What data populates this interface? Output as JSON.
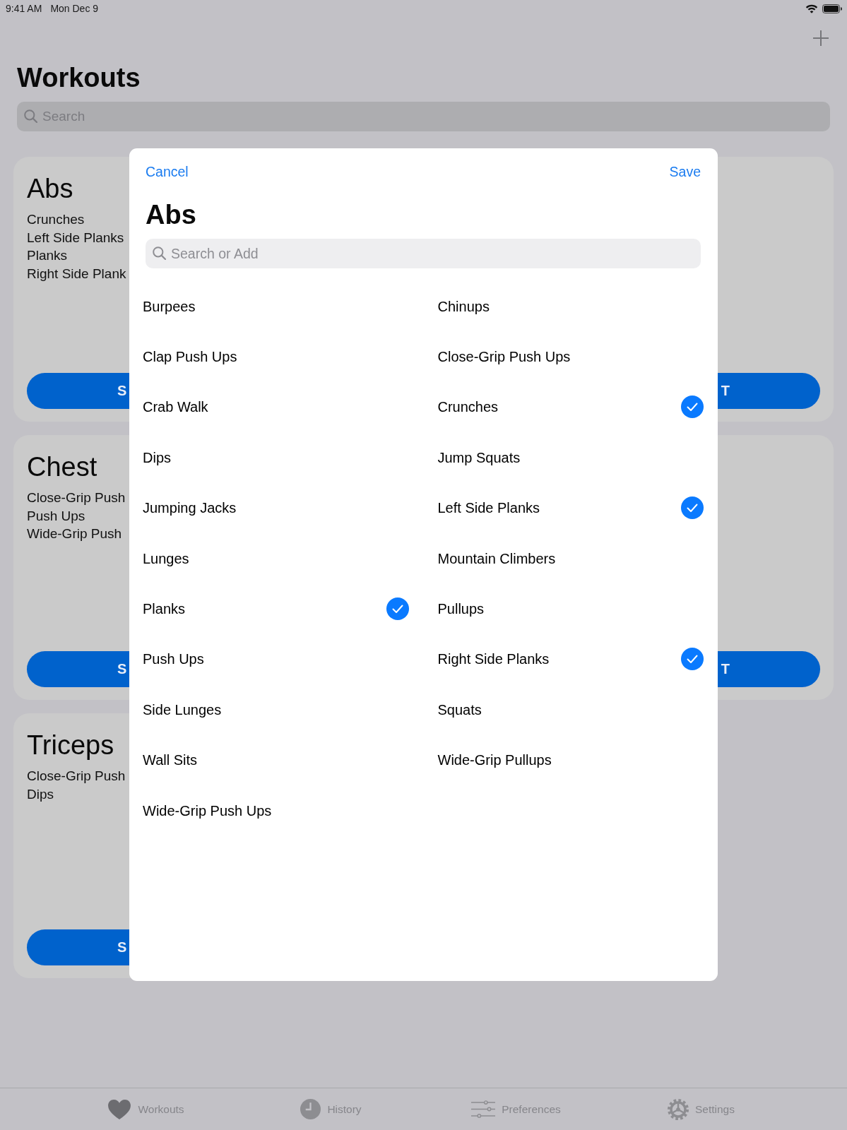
{
  "status_bar": {
    "time": "9:41 AM",
    "date": "Mon Dec 9"
  },
  "nav_bar": {
    "title": "Workouts"
  },
  "search": {
    "placeholder": "Search"
  },
  "workout_cards": [
    {
      "title": "Abs",
      "exercises": [
        "Crunches",
        "Left Side Planks",
        "Planks",
        "Right Side Plank"
      ],
      "button_text": "S"
    },
    {
      "button_text": "T"
    },
    {
      "title": "Chest",
      "exercises": [
        "Close-Grip Push",
        "Push Ups",
        "Wide-Grip Push"
      ],
      "button_text": "S"
    },
    {
      "button_text": "T"
    },
    {
      "title": "Triceps",
      "exercises": [
        "Close-Grip Push",
        "Dips"
      ],
      "button_text": "S"
    }
  ],
  "sheet": {
    "cancel": "Cancel",
    "save": "Save",
    "title": "Abs",
    "search": {
      "placeholder": "Search or Add"
    },
    "items": [
      {
        "label": "Burpees",
        "selected": false
      },
      {
        "label": "Chinups",
        "selected": false
      },
      {
        "label": "Clap Push Ups",
        "selected": false
      },
      {
        "label": "Close-Grip Push Ups",
        "selected": false
      },
      {
        "label": "Crab Walk",
        "selected": false
      },
      {
        "label": "Crunches",
        "selected": true
      },
      {
        "label": "Dips",
        "selected": false
      },
      {
        "label": "Jump Squats",
        "selected": false
      },
      {
        "label": "Jumping Jacks",
        "selected": false
      },
      {
        "label": "Left Side Planks",
        "selected": true
      },
      {
        "label": "Lunges",
        "selected": false
      },
      {
        "label": "Mountain Climbers",
        "selected": false
      },
      {
        "label": "Planks",
        "selected": true
      },
      {
        "label": "Pullups",
        "selected": false
      },
      {
        "label": "Push Ups",
        "selected": false
      },
      {
        "label": "Right Side Planks",
        "selected": true
      },
      {
        "label": "Side Lunges",
        "selected": false
      },
      {
        "label": "Squats",
        "selected": false
      },
      {
        "label": "Wall Sits",
        "selected": false
      },
      {
        "label": "Wide-Grip Pullups",
        "selected": false
      },
      {
        "label": "Wide-Grip Push Ups",
        "selected": false
      }
    ]
  },
  "tabs": [
    {
      "label": "Workouts",
      "selected": true
    },
    {
      "label": "History",
      "selected": false
    },
    {
      "label": "Preferences",
      "selected": false
    },
    {
      "label": "Settings",
      "selected": false
    }
  ]
}
